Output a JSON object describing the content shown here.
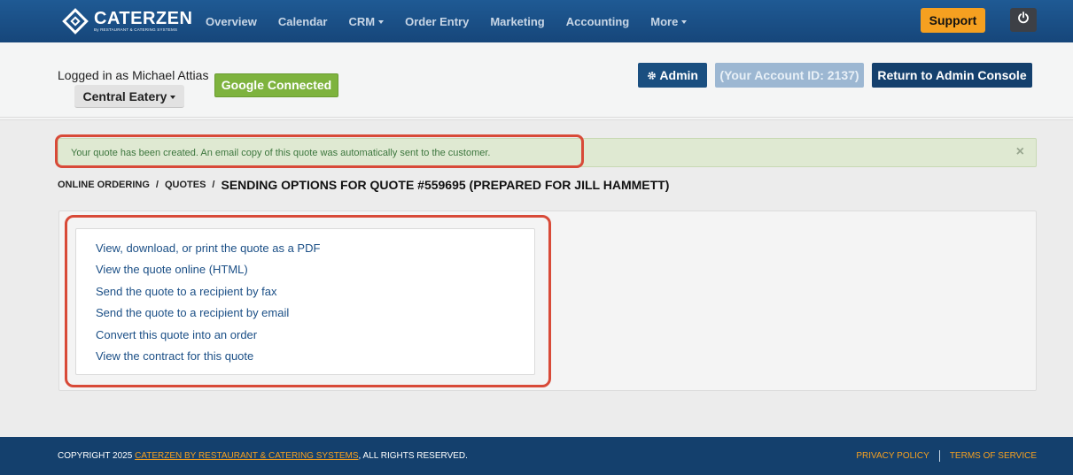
{
  "brand": {
    "name": "CATERZEN",
    "tagline": "By RESTAURANT & CATERING SYSTEMS"
  },
  "nav": {
    "items": [
      {
        "label": "Overview",
        "dropdown": false
      },
      {
        "label": "Calendar",
        "dropdown": false
      },
      {
        "label": "CRM",
        "dropdown": true
      },
      {
        "label": "Order Entry",
        "dropdown": false
      },
      {
        "label": "Marketing",
        "dropdown": false
      },
      {
        "label": "Accounting",
        "dropdown": false
      },
      {
        "label": "More",
        "dropdown": true
      }
    ],
    "support_label": "Support"
  },
  "account": {
    "logged_in_text": "Logged in as Michael Attias",
    "location_label": "Central Eatery",
    "google_label": "Google Connected",
    "admin_label": "Admin",
    "account_id_label": "(Your Account ID: 2137)",
    "return_label": "Return to Admin Console"
  },
  "alert": {
    "message": "Your quote has been created. An email copy of this quote was automatically sent to the customer.",
    "close_symbol": "×"
  },
  "breadcrumb": {
    "items": [
      "ONLINE ORDERING",
      "QUOTES"
    ],
    "separator": "/",
    "current": "SENDING OPTIONS FOR QUOTE #559695 (PREPARED FOR JILL HAMMETT)"
  },
  "options": [
    "View, download, or print the quote as a PDF",
    "View the quote online (HTML)",
    "Send the quote to a recipient by fax",
    "Send the quote to a recipient by email",
    "Convert this quote into an order",
    "View the contract for this quote"
  ],
  "footer": {
    "copyright_prefix": "COPYRIGHT 2025 ",
    "copyright_link": "CATERZEN BY RESTAURANT & CATERING SYSTEMS",
    "copyright_suffix": ", ALL RIGHTS RESERVED.",
    "privacy_label": "PRIVACY POLICY",
    "terms_label": "TERMS OF SERVICE"
  },
  "colors": {
    "nav_bg": "#16467a",
    "support": "#f5a020",
    "google": "#7eb33e",
    "alert_bg": "#dfe9d2",
    "highlight": "#d84a38",
    "link": "#1b4f86",
    "footer_bg": "#14406d"
  }
}
